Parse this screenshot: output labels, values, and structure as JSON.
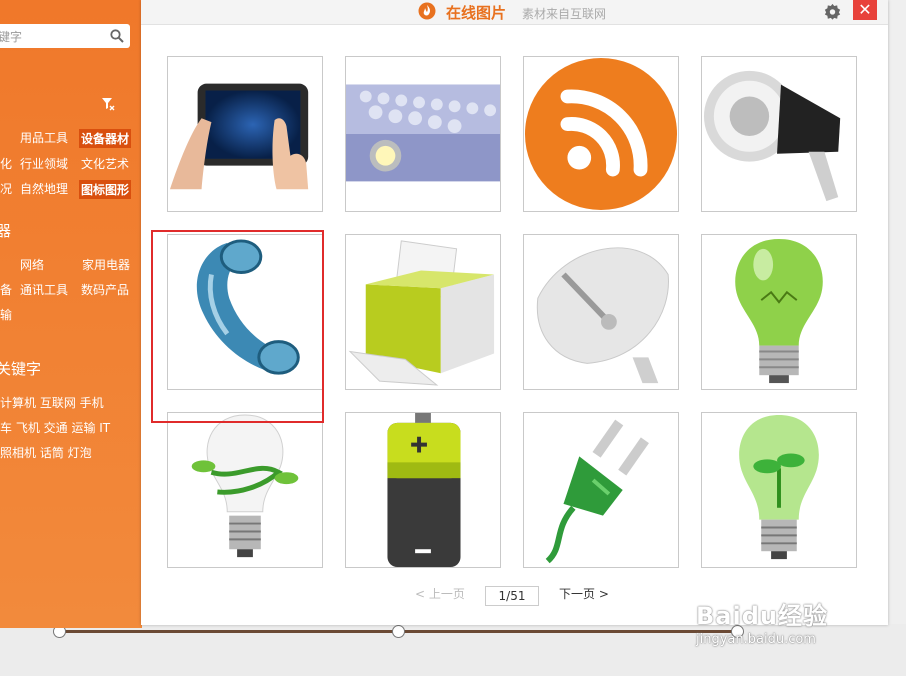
{
  "sidebar": {
    "search_placeholder": "键字",
    "categories": [
      {
        "items": [
          "用品工具",
          "设备器材"
        ],
        "active": 1
      },
      {
        "items": [
          "化",
          "行业领域",
          "文化艺术"
        ],
        "active": -1
      },
      {
        "items": [
          "况",
          "自然地理",
          "图标图形"
        ],
        "active": 2
      }
    ],
    "section_char": "器",
    "sub_rows": [
      {
        "items": [
          "",
          "网络",
          "家用电器"
        ]
      },
      {
        "items": [
          "备",
          "通讯工具",
          "数码产品"
        ]
      },
      {
        "items": [
          "输"
        ]
      }
    ],
    "hot_title": "关键字",
    "hot_rows": [
      "计算机 互联网 手机",
      "车 飞机 交通 运输 IT",
      "照相机 话筒 灯泡"
    ]
  },
  "dialog": {
    "title": "在线图片",
    "subtitle": "素材来自互联网",
    "close_label": "✕"
  },
  "images": [
    {
      "icon": "tablet-hand-icon"
    },
    {
      "icon": "lightbulbs-grid-icon"
    },
    {
      "icon": "rss-icon"
    },
    {
      "icon": "megaphone-icon"
    },
    {
      "icon": "telephone-receiver-icon"
    },
    {
      "icon": "printer-icon"
    },
    {
      "icon": "satellite-dish-icon"
    },
    {
      "icon": "green-lightbulb-icon"
    },
    {
      "icon": "eco-lightbulb-vine-icon"
    },
    {
      "icon": "battery-icon"
    },
    {
      "icon": "green-plug-icon"
    },
    {
      "icon": "sprout-lightbulb-icon"
    }
  ],
  "pager": {
    "prev_label": "< 上一页",
    "page_value": "1/51",
    "next_label": "下一页 >"
  },
  "watermark": {
    "brand": "Baidu经验",
    "url": "jingyan.baidu.com"
  },
  "colors": {
    "accent": "#f0782a",
    "highlight": "#e02b2b",
    "close": "#e8423b"
  }
}
